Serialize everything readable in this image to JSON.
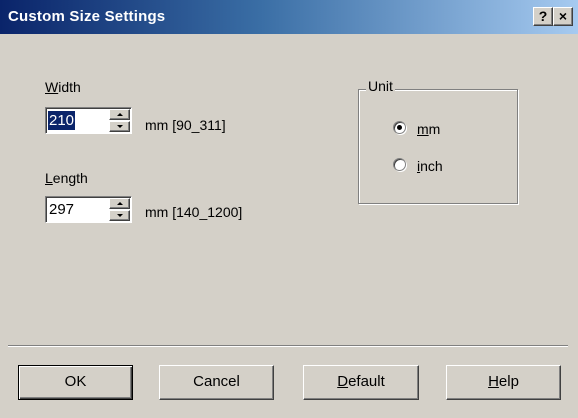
{
  "window": {
    "title": "Custom Size Settings",
    "help_button": "?",
    "close_button": "×"
  },
  "width": {
    "label": "Width",
    "mnemonic": "W",
    "label_rest": "idth",
    "value": "210",
    "range": "mm [90_311]"
  },
  "length": {
    "label": "Length",
    "mnemonic": "L",
    "label_rest": "ength",
    "value": "297",
    "range": "mm [140_1200]"
  },
  "unit": {
    "title": "Unit",
    "options": [
      {
        "label": "mm",
        "mnemonic": "m",
        "label_rest": "m",
        "selected": true
      },
      {
        "label": "inch",
        "mnemonic": "i",
        "label_rest": "nch",
        "selected": false
      }
    ]
  },
  "buttons": {
    "ok": "OK",
    "cancel": "Cancel",
    "default": "Default",
    "default_mnemonic": "D",
    "default_rest": "efault",
    "help": "Help",
    "help_mnemonic": "H",
    "help_rest": "elp"
  }
}
